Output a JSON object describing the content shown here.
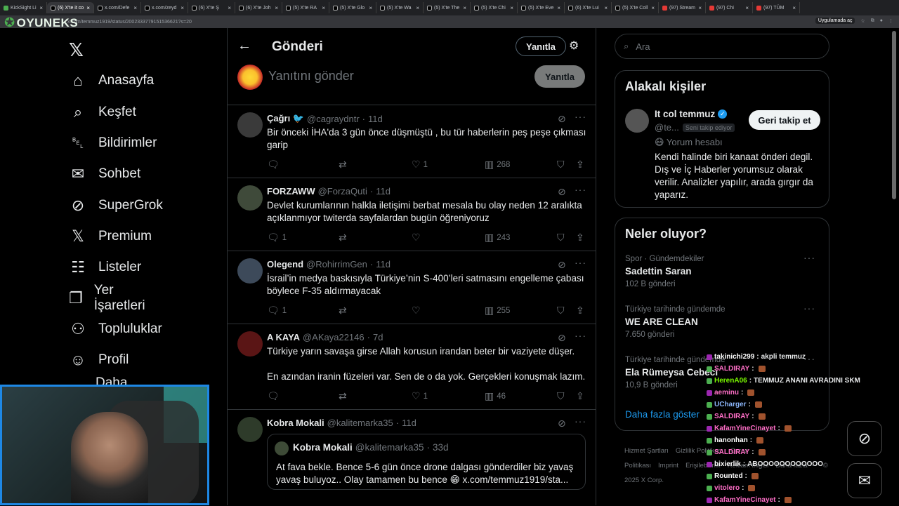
{
  "browser": {
    "tabs": [
      {
        "label": "KickSight Li",
        "favicon": "kick",
        "active": false
      },
      {
        "label": "(6) X'te it co",
        "favicon": "x",
        "active": true
      },
      {
        "label": "x.com/Defe",
        "favicon": "x",
        "active": false
      },
      {
        "label": "x.com/zeyd",
        "favicon": "x",
        "active": false
      },
      {
        "label": "(6) X'te Ş",
        "favicon": "x",
        "active": false
      },
      {
        "label": "(6) X'te Joh",
        "favicon": "x",
        "active": false
      },
      {
        "label": "(5) X'te RA",
        "favicon": "x",
        "active": false
      },
      {
        "label": "(5) X'te Glo",
        "favicon": "x",
        "active": false
      },
      {
        "label": "(5) X'te Wa",
        "favicon": "x",
        "active": false
      },
      {
        "label": "(5) X'te The",
        "favicon": "x",
        "active": false
      },
      {
        "label": "(5) X'te Chi",
        "favicon": "x",
        "active": false
      },
      {
        "label": "(5) X'te Eve",
        "favicon": "x",
        "active": false
      },
      {
        "label": "(6) X'te Lui",
        "favicon": "x",
        "active": false
      },
      {
        "label": "(5) X'te Coll",
        "favicon": "x",
        "active": false
      },
      {
        "label": "(97) Stream",
        "favicon": "youtube",
        "active": false
      },
      {
        "label": "(97) Chi",
        "favicon": "youtube",
        "active": false
      },
      {
        "label": "(97) TÜM",
        "favicon": "youtube",
        "active": false
      }
    ],
    "url": "x.com/temmuz1919/status/2002333779151536621?s=20",
    "app_chip": "Uygulamada aç"
  },
  "overlay_logo": "OYUNEKS",
  "sidebar": {
    "items": [
      {
        "label": "Anasayfa",
        "icon": "home-icon",
        "glyph": "⌂"
      },
      {
        "label": "Keşfet",
        "icon": "search-icon",
        "glyph": "⌕"
      },
      {
        "label": "Bildirimler",
        "icon": "bell-icon",
        "glyph": "␇",
        "badge": "6"
      },
      {
        "label": "Sohbet",
        "icon": "mail-icon",
        "glyph": "✉"
      },
      {
        "label": "SuperGrok",
        "icon": "grok-icon",
        "glyph": "⊘"
      },
      {
        "label": "Premium",
        "icon": "x-premium-icon",
        "glyph": "𝕏"
      },
      {
        "label": "Listeler",
        "icon": "list-icon",
        "glyph": "☷"
      },
      {
        "label": "Yer İşaretleri",
        "icon": "bookmark-icon",
        "glyph": "❐"
      },
      {
        "label": "Topluluklar",
        "icon": "communities-icon",
        "glyph": "⚇"
      },
      {
        "label": "Profil",
        "icon": "profile-icon",
        "glyph": "☺"
      },
      {
        "label": "Daha fazla",
        "icon": "more-icon",
        "glyph": "⋯"
      }
    ]
  },
  "main": {
    "title": "Gönderi",
    "reply_filter_label": "Yanıtla",
    "composer": {
      "placeholder": "Yanıtını gönder",
      "button": "Yanıtla"
    },
    "tweets": [
      {
        "name": "Çağrı 🐦",
        "handle": "@cagraydntr",
        "time": "11d",
        "text": "Bir önceki İHA'da 3 gün önce düşmüştü , bu tür haberlerin peş peşe çıkması garip",
        "replies": "",
        "likes": "1",
        "views": "268"
      },
      {
        "name": "FORZAWW",
        "handle": "@ForzaQuti",
        "time": "11d",
        "text": "Devlet kurumlarının halkla iletişimi berbat mesala bu olay neden 12 aralıkta açıklanmıyor twiterda sayfalardan bugün öğreniyoruz",
        "replies": "1",
        "likes": "",
        "views": "243"
      },
      {
        "name": "Olegend",
        "handle": "@RohirrimGen",
        "time": "11d",
        "text": "İsrail’in medya baskısıyla Türkiye’nin S-400’leri satmasını engelleme çabası böylece F-35 aldırmayacak",
        "replies": "1",
        "likes": "",
        "views": "255"
      },
      {
        "name": "A KAYA",
        "handle": "@AKaya22146",
        "time": "7d",
        "text": "Türkiye yarın savaşa girse Allah korusun irandan beter bir vaziyete düşer.\n\nEn azından iranin füzeleri var. Sen de o da yok. Gerçekleri konuşmak lazım.",
        "replies": "",
        "likes": "1",
        "views": "46"
      },
      {
        "name": "Kobra Mokali",
        "handle": "@kalitemarka35",
        "time": "11d",
        "quote": {
          "name": "Kobra Mokali",
          "handle": "@kalitemarka35",
          "time": "33d",
          "text": "At fava bekle. Bence 5-6 gün önce drone dalgası gönderdiler biz yavaş yavaş buluyoz.. Olay tamamen bu bence 😁 x.com/temmuz1919/sta..."
        }
      }
    ]
  },
  "right": {
    "search_placeholder": "Ara",
    "relevant": {
      "title": "Alakalı kişiler",
      "name": "It col temmuz",
      "handle": "@te...",
      "follows_you": "Seni takip ediyor",
      "follow_button": "Geri takip et",
      "label": "😷 Yorum hesabı",
      "bio": "Kendi halinde biri kanaat önderi degil. Dış ve İç Haberler yorumsuz olarak verilir. Analizler yapılır, arada gırgır da yaparız."
    },
    "trends": {
      "title": "Neler oluyor?",
      "items": [
        {
          "category": "Spor · Gündemdekiler",
          "name": "Sadettin Saran",
          "count": "102 B gönderi"
        },
        {
          "category": "Türkiye tarihinde gündemde",
          "name": "WE ARE CLEAN",
          "count": "7.650 gönderi"
        },
        {
          "category": "Türkiye tarihinde gündemde",
          "name": "Ela Rümeysa Cebeci",
          "count": "10,9 B gönderi"
        }
      ],
      "show_more": "Daha fazla göster"
    },
    "footer": [
      "Hizmet Şartları",
      "Gizlilik Politikası",
      "Çerez Politikası",
      "Imprint",
      "Erişilebilirlik",
      "Reklam bilgisi",
      "Daha fazla ···",
      "© 2025 X Corp."
    ]
  },
  "chat": [
    {
      "user": "takinichi299",
      "msg": "akpli temmuz",
      "color": "#ffffff"
    },
    {
      "user": "SALDIRAY",
      "msg": "",
      "color": "#ff6ec7"
    },
    {
      "user": "HerenA06",
      "msg": "TEMMUZ ANANI AVRADINI SKM",
      "color": "#7cfc00"
    },
    {
      "user": "aeminu",
      "msg": "",
      "color": "#ff6ec7"
    },
    {
      "user": "UCharger",
      "msg": "",
      "color": "#8ab4f8"
    },
    {
      "user": "SALDIRAY",
      "msg": "",
      "color": "#ff6ec7"
    },
    {
      "user": "KafamYineCinayet",
      "msg": "",
      "color": "#ff6ec7"
    },
    {
      "user": "hanonhan",
      "msg": "",
      "color": "#ffffff"
    },
    {
      "user": "SALDIRAY",
      "msg": "",
      "color": "#ff6ec7"
    },
    {
      "user": "bixierlik",
      "msg": "ABOOOOOOOOOOOO",
      "color": "#ffffff"
    },
    {
      "user": "Rounted",
      "msg": "",
      "color": "#ffffff"
    },
    {
      "user": "vitolero",
      "msg": "",
      "color": "#ff6ec7"
    },
    {
      "user": "KafamYineCinayet",
      "msg": "",
      "color": "#ff6ec7"
    }
  ]
}
